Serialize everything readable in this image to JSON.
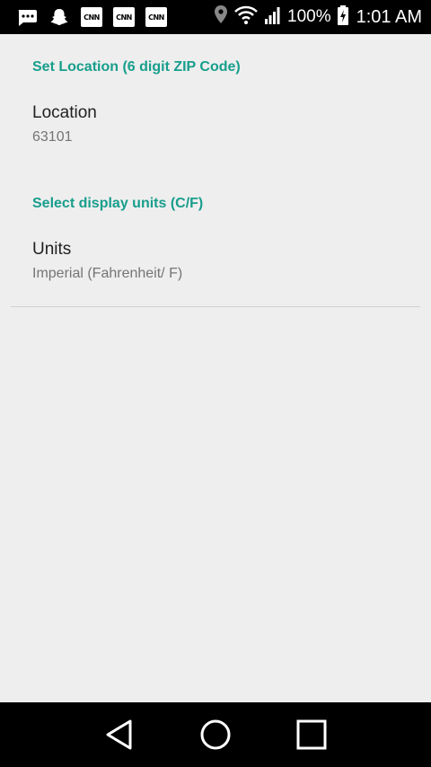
{
  "status_bar": {
    "notifications": [
      "message-icon",
      "snapchat-icon",
      "cnn-icon",
      "cnn-icon",
      "cnn-icon"
    ],
    "cnn_label": "CNN",
    "battery": "100%",
    "time": "1:01 AM"
  },
  "settings": {
    "location_category": "Set Location (6 digit ZIP Code)",
    "location_title": "Location",
    "location_value": "63101",
    "units_category": "Select display units (C/F)",
    "units_title": "Units",
    "units_value": "Imperial (Fahrenheit/ F)"
  },
  "colors": {
    "accent": "#179e8c",
    "background": "#eeeeee"
  }
}
